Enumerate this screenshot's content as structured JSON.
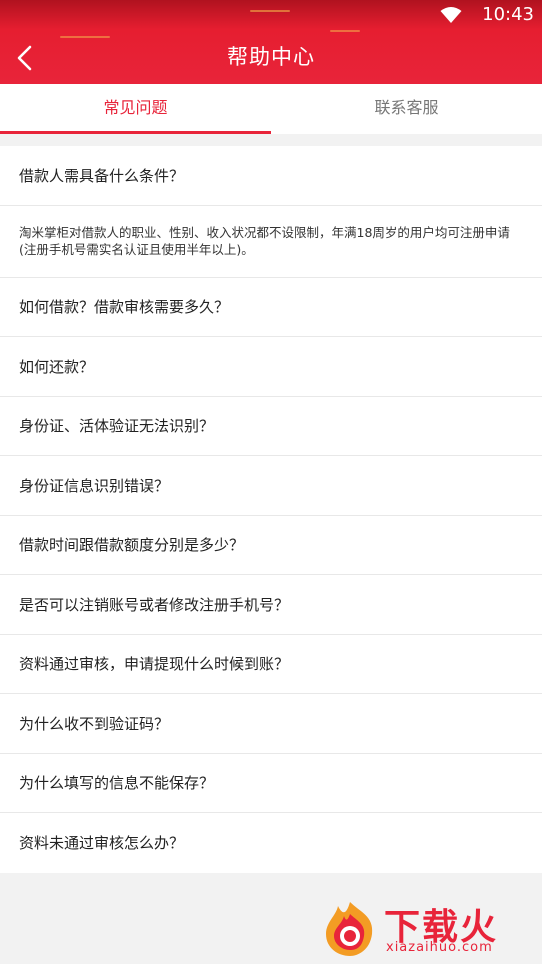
{
  "status_bar": {
    "time": "10:43"
  },
  "header": {
    "title": "帮助中心"
  },
  "tabs": [
    {
      "label": "常见问题",
      "active": true
    },
    {
      "label": "联系客服",
      "active": false
    }
  ],
  "faq": {
    "first_question": "借款人需具备什么条件？",
    "first_answer": "淘米掌柜对借款人的职业、性别、收入状况都不设限制，年满18周岁的用户均可注册申请(注册手机号需实名认证且使用半年以上)。",
    "questions": [
      "如何借款？借款审核需要多久？",
      "如何还款？",
      "身份证、活体验证无法识别？",
      "身份证信息识别错误？",
      "借款时间跟借款额度分别是多少？",
      "是否可以注销账号或者修改注册手机号？",
      "资料通过审核，申请提现什么时候到账？",
      "为什么收不到验证码？",
      "为什么填写的信息不能保存？",
      "资料未通过审核怎么办？"
    ]
  },
  "watermark": {
    "brand": "下载火",
    "domain": "xiazaihuo.com"
  },
  "colors": {
    "accent": "#e8243a",
    "header_dark": "#b0121f"
  }
}
